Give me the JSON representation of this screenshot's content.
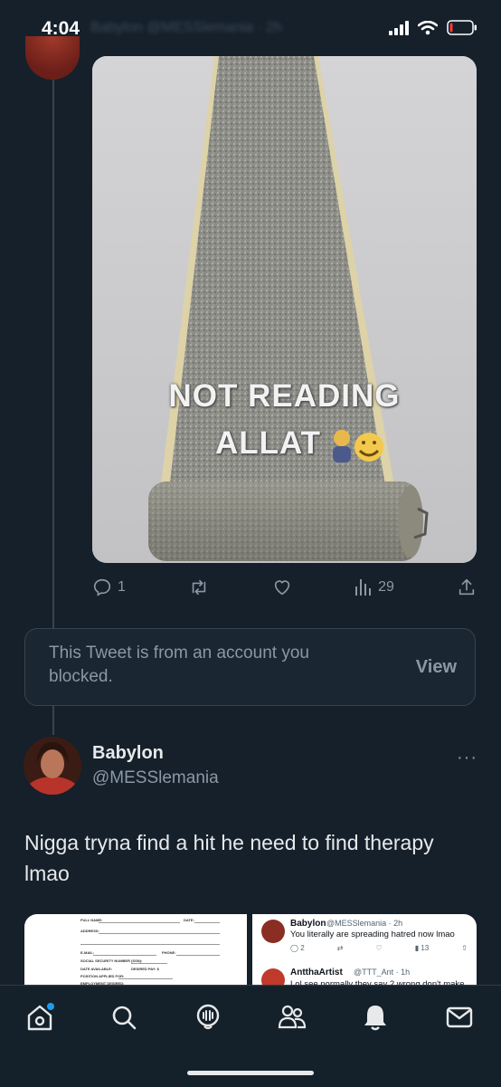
{
  "status": {
    "time": "4:04",
    "blurred_header": "Babylon @MESSlemania · 2h"
  },
  "media": {
    "caption_line1": "NOT READING",
    "caption_line2": "ALLAT"
  },
  "actions": {
    "replies": "1",
    "views": "29"
  },
  "blocked": {
    "message": "This Tweet is from an account you blocked.",
    "view_label": "View"
  },
  "tweet": {
    "display_name": "Babylon",
    "handle": "@MESSlemania",
    "more": "···",
    "text": "Nigga tryna find a hit he need to find therapy lmao"
  },
  "quoted_preview": {
    "form": {
      "full_name": "FULL NAME:",
      "date": "DATE:",
      "address": "ADDRESS:",
      "email": "E-MAIL:",
      "phone": "PHONE:",
      "ssn": "SOCIAL SECURITY NUMBER (SSN):",
      "date_available": "DATE AVAILABLE:",
      "desired_pay": "DESIRED PAY: $",
      "position": "POSITION APPLIED FOR:",
      "employment": "EMPLOYMENT DESIRED:"
    },
    "tweet1": {
      "name": "Babylon",
      "handle_time": "@MESSlemania · 2h",
      "text": "You literally are spreading hatred now lmao",
      "replies": "2",
      "views": "13"
    },
    "tweet2": {
      "name": "AntthaArtist",
      "handle_time": "@TTT_Ant · 1h",
      "text": "Lol see normally they say 2 wrong don't make"
    }
  },
  "colors": {
    "background": "#15202b",
    "accent": "#1d9bf0",
    "muted": "#8b98a5"
  }
}
